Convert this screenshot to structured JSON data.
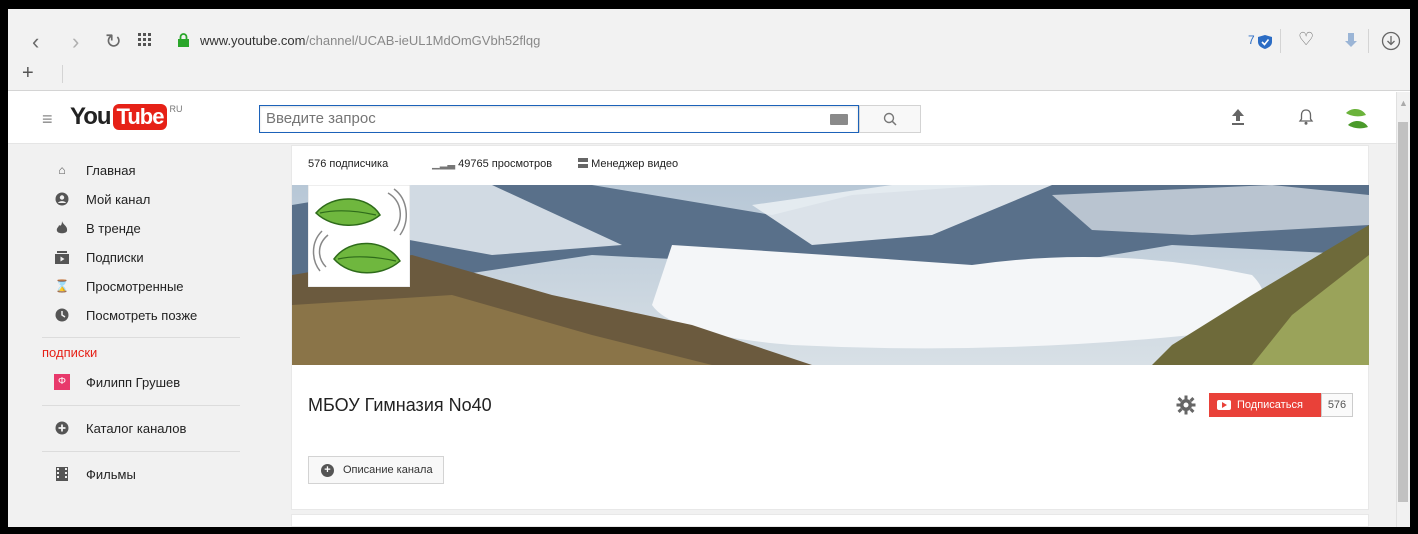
{
  "browser": {
    "url_domain": "www.youtube.com",
    "url_path": "/channel/UCAB-ieUL1MdOmGVbh52flqg",
    "badge_count": "7"
  },
  "masthead": {
    "logo_you": "You",
    "logo_tube": "Tube",
    "logo_region": "RU",
    "search_placeholder": "Введите запрос"
  },
  "sidebar": {
    "items": [
      {
        "label": "Главная",
        "icon": "home-icon"
      },
      {
        "label": "Мой канал",
        "icon": "person-icon"
      },
      {
        "label": "В тренде",
        "icon": "flame-icon"
      },
      {
        "label": "Подписки",
        "icon": "subscriptions-icon"
      },
      {
        "label": "Просмотренные",
        "icon": "hourglass-icon"
      },
      {
        "label": "Посмотреть позже",
        "icon": "clock-icon"
      }
    ],
    "subscriptions_heading": "подписки",
    "subscriptions": [
      {
        "label": "Филипп Грушев",
        "icon_color": "#e8396b"
      }
    ],
    "catalog_label": "Каталог каналов",
    "movies_label": "Фильмы"
  },
  "channel": {
    "subscribers": "576 подписчика",
    "views": "49765 просмотров",
    "video_manager": "Менеджер видео",
    "name": "МБОУ Гимназия No40",
    "subscribe_label": "Подписаться",
    "subscribe_count": "576",
    "description_button": "Описание канала"
  },
  "colors": {
    "brand_red": "#e62117",
    "search_border": "#1c62b9"
  }
}
